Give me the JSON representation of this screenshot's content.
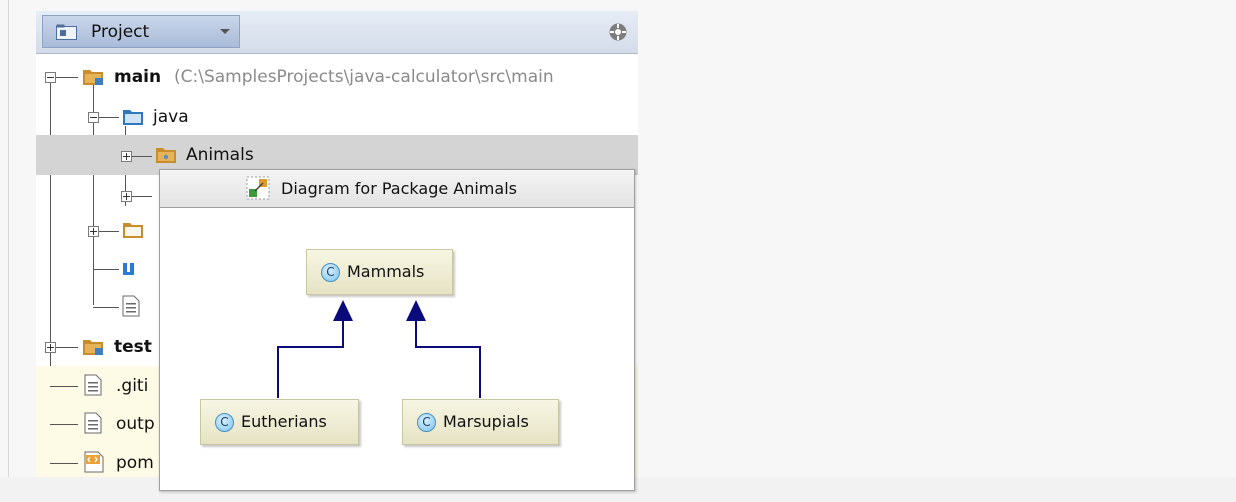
{
  "panel": {
    "tab_label": "Project",
    "icons": {
      "project": "project-folder-icon",
      "dropdown": "chevron-down-icon",
      "target": "scroll-from-source-icon"
    }
  },
  "tree": {
    "main": {
      "label": "main",
      "path": "(C:\\SamplesProjects\\java-calculator\\src\\main"
    },
    "java": {
      "label": "java"
    },
    "animals": {
      "label": "Animals"
    },
    "test": {
      "label": "test"
    },
    "gitignore": {
      "label": ".giti"
    },
    "output": {
      "label": "outp"
    },
    "pom": {
      "label": "pom"
    }
  },
  "popup": {
    "title": "Diagram for Package Animals",
    "icon": "diagram-icon"
  },
  "diagram": {
    "badge": "C",
    "nodes": [
      {
        "label": "Mammals"
      },
      {
        "label": "Eutherians"
      },
      {
        "label": "Marsupials"
      }
    ],
    "edges": [
      {
        "from": "Eutherians",
        "to": "Mammals"
      },
      {
        "from": "Marsupials",
        "to": "Mammals"
      }
    ],
    "edge_color": "#0a0a7a"
  },
  "colors": {
    "selected_row": "#d4d4d4",
    "ignored_row": "#fdfbe6",
    "header": "#d3dce9"
  }
}
